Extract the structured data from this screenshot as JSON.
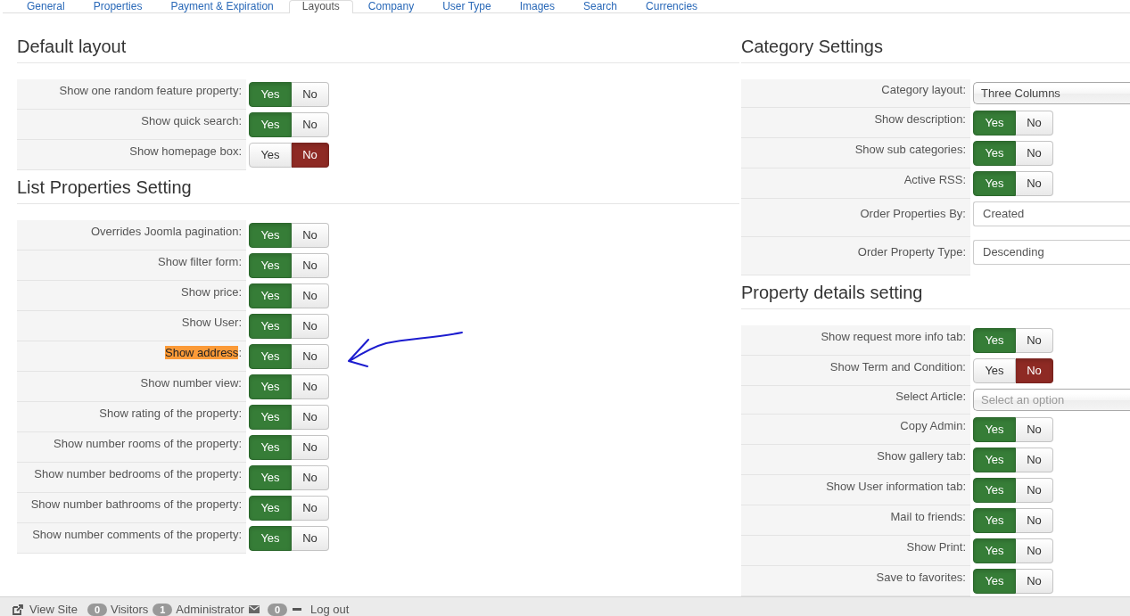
{
  "tabs": [
    {
      "label": "General",
      "selected": false
    },
    {
      "label": "Properties",
      "selected": false
    },
    {
      "label": "Payment & Expiration",
      "selected": false
    },
    {
      "label": "Layouts",
      "selected": true
    },
    {
      "label": "Company",
      "selected": false
    },
    {
      "label": "User Type",
      "selected": false
    },
    {
      "label": "Images",
      "selected": false
    },
    {
      "label": "Search",
      "selected": false
    },
    {
      "label": "Currencies",
      "selected": false
    }
  ],
  "columns": [
    {
      "sections": [
        {
          "title": "Default layout",
          "rows": [
            {
              "kind": "toggle",
              "label": "Show one random feature property:",
              "options": [
                {
                  "label": "Yes",
                  "selected": true
                },
                {
                  "label": "No",
                  "selected": false
                }
              ]
            },
            {
              "kind": "toggle",
              "label": "Show quick search:",
              "options": [
                {
                  "label": "Yes",
                  "selected": true
                },
                {
                  "label": "No",
                  "selected": false
                }
              ]
            },
            {
              "kind": "toggle",
              "label": "Show homepage box:",
              "options": [
                {
                  "label": "Yes",
                  "selected": false
                },
                {
                  "label": "No",
                  "selected": true
                }
              ]
            }
          ]
        },
        {
          "title": "List Properties Setting",
          "rows": [
            {
              "kind": "toggle",
              "label": "Overrides Joomla pagination:",
              "highlighted": false,
              "arrow": false,
              "options": [
                {
                  "label": "Yes",
                  "selected": true
                },
                {
                  "label": "No",
                  "selected": false
                }
              ]
            },
            {
              "kind": "toggle",
              "label": "Show filter form:",
              "highlighted": false,
              "arrow": false,
              "options": [
                {
                  "label": "Yes",
                  "selected": true
                },
                {
                  "label": "No",
                  "selected": false
                }
              ]
            },
            {
              "kind": "toggle",
              "label": "Show price:",
              "highlighted": false,
              "arrow": false,
              "options": [
                {
                  "label": "Yes",
                  "selected": true
                },
                {
                  "label": "No",
                  "selected": false
                }
              ]
            },
            {
              "kind": "toggle",
              "label": "Show User:",
              "highlighted": false,
              "arrow": false,
              "options": [
                {
                  "label": "Yes",
                  "selected": true
                },
                {
                  "label": "No",
                  "selected": false
                }
              ]
            },
            {
              "kind": "toggle",
              "label": "Show address:",
              "highlighted": true,
              "arrow": true,
              "options": [
                {
                  "label": "Yes",
                  "selected": true
                },
                {
                  "label": "No",
                  "selected": false
                }
              ]
            },
            {
              "kind": "toggle",
              "label": "Show number view:",
              "highlighted": false,
              "arrow": false,
              "options": [
                {
                  "label": "Yes",
                  "selected": true
                },
                {
                  "label": "No",
                  "selected": false
                }
              ]
            },
            {
              "kind": "toggle",
              "label": "Show rating of the property:",
              "highlighted": false,
              "arrow": false,
              "options": [
                {
                  "label": "Yes",
                  "selected": true
                },
                {
                  "label": "No",
                  "selected": false
                }
              ]
            },
            {
              "kind": "toggle",
              "label": "Show number rooms of the property:",
              "highlighted": false,
              "arrow": false,
              "options": [
                {
                  "label": "Yes",
                  "selected": true
                },
                {
                  "label": "No",
                  "selected": false
                }
              ]
            },
            {
              "kind": "toggle",
              "label": "Show number bedrooms of the property:",
              "highlighted": false,
              "arrow": false,
              "options": [
                {
                  "label": "Yes",
                  "selected": true
                },
                {
                  "label": "No",
                  "selected": false
                }
              ]
            },
            {
              "kind": "toggle",
              "label": "Show number bathrooms of the property:",
              "highlighted": false,
              "arrow": false,
              "options": [
                {
                  "label": "Yes",
                  "selected": true
                },
                {
                  "label": "No",
                  "selected": false
                }
              ]
            },
            {
              "kind": "toggle",
              "label": "Show number comments of the property:",
              "highlighted": false,
              "arrow": false,
              "options": [
                {
                  "label": "Yes",
                  "selected": true
                },
                {
                  "label": "No",
                  "selected": false
                }
              ]
            }
          ]
        }
      ]
    },
    {
      "sections": [
        {
          "title": "Category Settings",
          "rows": [
            {
              "kind": "chosen",
              "label": "Category layout:",
              "value": "Three Columns"
            },
            {
              "kind": "toggle",
              "label": "Show description:",
              "options": [
                {
                  "label": "Yes",
                  "selected": true
                },
                {
                  "label": "No",
                  "selected": false
                }
              ]
            },
            {
              "kind": "toggle",
              "label": "Show sub categories:",
              "options": [
                {
                  "label": "Yes",
                  "selected": true
                },
                {
                  "label": "No",
                  "selected": false
                }
              ]
            },
            {
              "kind": "toggle",
              "label": "Active RSS:",
              "options": [
                {
                  "label": "Yes",
                  "selected": true
                },
                {
                  "label": "No",
                  "selected": false
                }
              ]
            },
            {
              "kind": "select",
              "label": "Order Properties By:",
              "value": "Created"
            },
            {
              "kind": "select",
              "label": "Order Property Type:",
              "value": "Descending"
            }
          ]
        },
        {
          "title": "Property details setting",
          "rows": [
            {
              "kind": "toggle",
              "label": "Show request more info tab:",
              "options": [
                {
                  "label": "Yes",
                  "selected": true
                },
                {
                  "label": "No",
                  "selected": false
                }
              ]
            },
            {
              "kind": "toggle",
              "label": "Show Term and Condition:",
              "options": [
                {
                  "label": "Yes",
                  "selected": false
                },
                {
                  "label": "No",
                  "selected": true
                }
              ]
            },
            {
              "kind": "chosen",
              "label": "Select Article:",
              "placeholder": "Select an option"
            },
            {
              "kind": "toggle",
              "label": "Copy Admin:",
              "options": [
                {
                  "label": "Yes",
                  "selected": true
                },
                {
                  "label": "No",
                  "selected": false
                }
              ]
            },
            {
              "kind": "toggle",
              "label": "Show gallery tab:",
              "options": [
                {
                  "label": "Yes",
                  "selected": true
                },
                {
                  "label": "No",
                  "selected": false
                }
              ]
            },
            {
              "kind": "toggle",
              "label": "Show User information tab:",
              "options": [
                {
                  "label": "Yes",
                  "selected": true
                },
                {
                  "label": "No",
                  "selected": false
                }
              ]
            },
            {
              "kind": "toggle",
              "label": "Mail to friends:",
              "options": [
                {
                  "label": "Yes",
                  "selected": true
                },
                {
                  "label": "No",
                  "selected": false
                }
              ]
            },
            {
              "kind": "toggle",
              "label": "Show Print:",
              "options": [
                {
                  "label": "Yes",
                  "selected": true
                },
                {
                  "label": "No",
                  "selected": false
                }
              ]
            },
            {
              "kind": "toggle",
              "label": "Save to favorites:",
              "options": [
                {
                  "label": "Yes",
                  "selected": true
                },
                {
                  "label": "No",
                  "selected": false
                }
              ]
            }
          ]
        }
      ]
    }
  ],
  "status_bar": {
    "items": [
      {
        "kind": "view_site",
        "label": "View Site"
      },
      {
        "kind": "counter",
        "count": "0",
        "label": "Visitors"
      },
      {
        "kind": "counter",
        "count": "1",
        "label": "Administrator"
      },
      {
        "kind": "messages",
        "count": "0"
      },
      {
        "kind": "logout",
        "label": "Log out"
      }
    ]
  }
}
